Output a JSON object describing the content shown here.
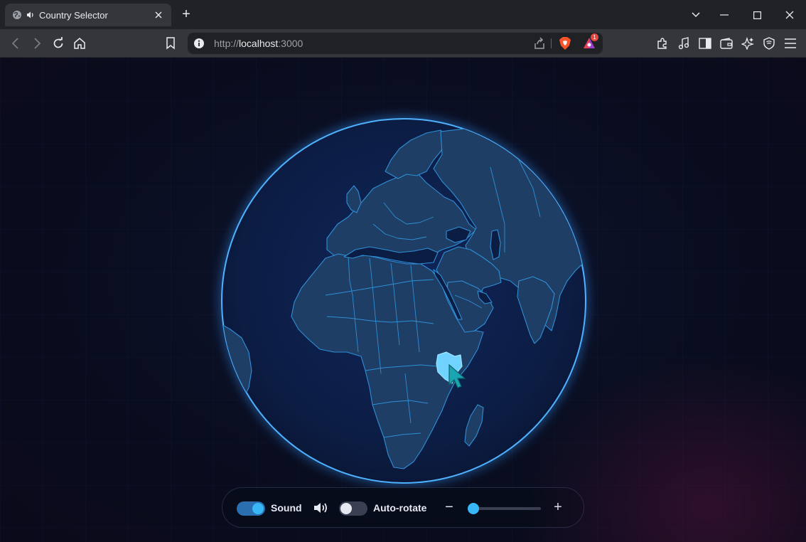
{
  "browser": {
    "tab": {
      "title": "Country Selector",
      "audio_playing": true
    },
    "url": {
      "scheme": "http://",
      "host": "localhost",
      "port": ":3000"
    },
    "rewards_badge": "1"
  },
  "app": {
    "globe": {
      "highlighted_country": "Kenya",
      "colors": {
        "ocean": "#0c1d40",
        "land": "#1e3e66",
        "border": "#2f8fd6",
        "highlight": "#6fd2ff",
        "glow": "#3aa5ff"
      }
    },
    "controls": {
      "sound_label": "Sound",
      "sound_on": true,
      "autorotate_label": "Auto-rotate",
      "autorotate_on": false,
      "zoom_minus": "−",
      "zoom_plus": "+",
      "zoom_level": 0.05
    }
  }
}
